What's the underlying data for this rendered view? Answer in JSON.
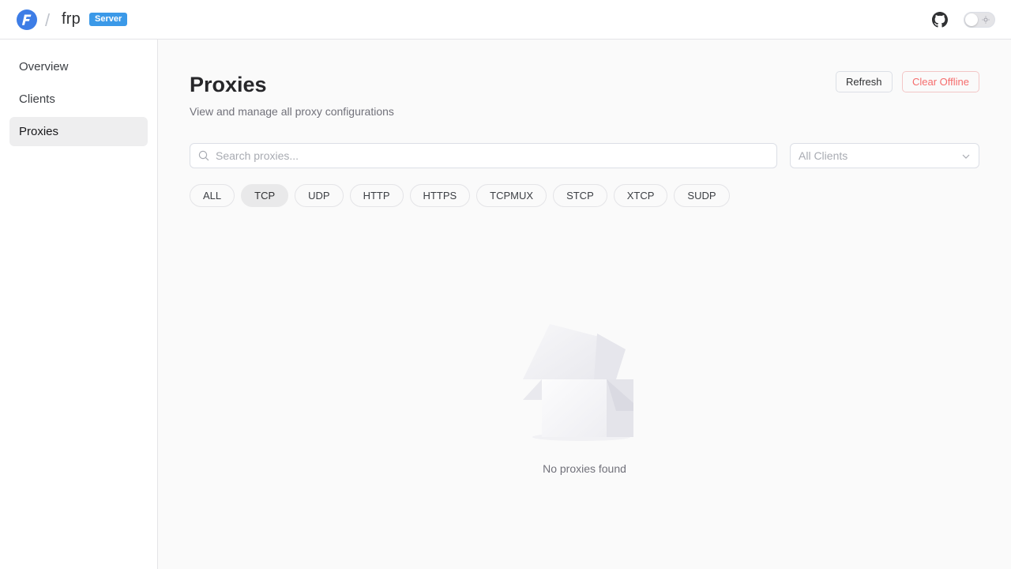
{
  "header": {
    "brand": "frp",
    "separator": "/",
    "badge": "Server"
  },
  "sidebar": {
    "items": [
      {
        "label": "Overview"
      },
      {
        "label": "Clients"
      },
      {
        "label": "Proxies",
        "active": true
      }
    ]
  },
  "page": {
    "title": "Proxies",
    "subtitle": "View and manage all proxy configurations",
    "refresh_label": "Refresh",
    "clear_offline_label": "Clear Offline"
  },
  "search": {
    "placeholder": "Search proxies...",
    "value": ""
  },
  "client_filter": {
    "selected": "All Clients"
  },
  "type_filters": {
    "items": [
      "ALL",
      "TCP",
      "UDP",
      "HTTP",
      "HTTPS",
      "TCPMUX",
      "STCP",
      "XTCP",
      "SUDP"
    ],
    "active": "TCP"
  },
  "empty_state": {
    "message": "No proxies found"
  },
  "colors": {
    "accent": "#3b99e8",
    "danger": "#f56c6c",
    "logo": "#3d7de6"
  }
}
